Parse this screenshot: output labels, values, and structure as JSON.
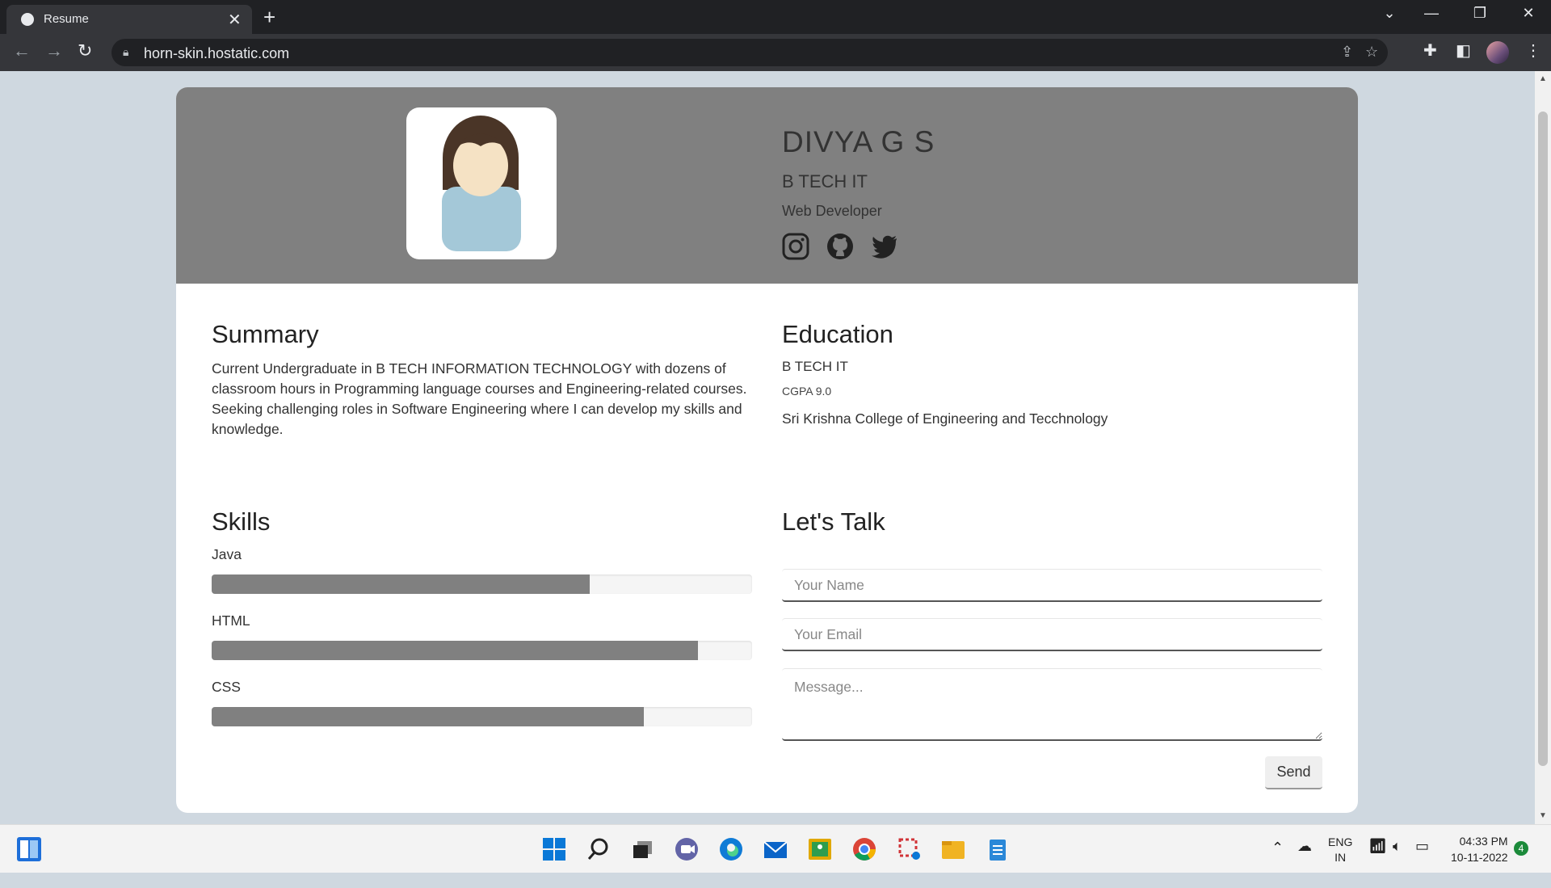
{
  "browser": {
    "tab_title": "Resume",
    "url": "horn-skin.hostatic.com"
  },
  "profile": {
    "name": "DIVYA G S",
    "degree": "B TECH IT",
    "role": "Web Developer",
    "socials": [
      "instagram-icon",
      "github-icon",
      "twitter-icon"
    ]
  },
  "summary": {
    "heading": "Summary",
    "text": "Current Undergraduate in B TECH INFORMATION TECHNOLOGY with dozens of classroom hours in Programming language courses and Engineering-related courses. Seeking challenging roles in Software Engineering where I can develop my skills and knowledge."
  },
  "education": {
    "heading": "Education",
    "degree": "B TECH IT",
    "cgpa": "CGPA 9.0",
    "college": "Sri Krishna College of Engineering and Tecchnology"
  },
  "skills": {
    "heading": "Skills",
    "items": [
      {
        "label": "Java",
        "level": 0.7
      },
      {
        "label": "HTML",
        "level": 0.9
      },
      {
        "label": "CSS",
        "level": 0.8
      }
    ]
  },
  "contact": {
    "heading": "Let's Talk",
    "name_placeholder": "Your Name",
    "email_placeholder": "Your Email",
    "message_placeholder": "Message...",
    "send_label": "Send"
  },
  "taskbar": {
    "lang_top": "ENG",
    "lang_bottom": "IN",
    "time": "04:33 PM",
    "date": "10-11-2022",
    "notification_count": "4"
  },
  "colors": {
    "header_bg": "#808080",
    "skill_fill": "#808080",
    "page_bg": "#cfd8e0"
  }
}
